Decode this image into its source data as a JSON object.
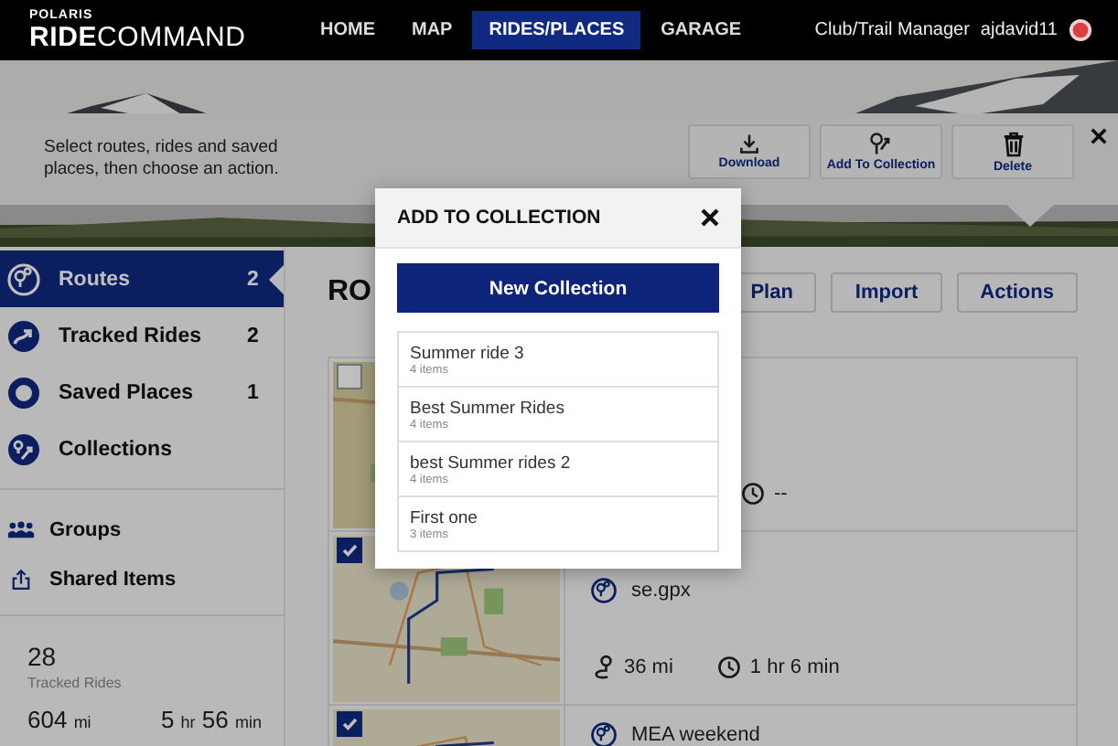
{
  "nav": {
    "brand_top": "POLARIS",
    "brand": "**RIDE**COMMAND",
    "items": [
      {
        "label": "HOME",
        "selected": false
      },
      {
        "label": "MAP",
        "selected": false
      },
      {
        "label": "RIDES/PLACES",
        "selected": true
      },
      {
        "label": "GARAGE",
        "selected": false
      }
    ],
    "manager_link": "Club/Trail Manager",
    "user": "ajdavid11"
  },
  "action_bar": {
    "hint": "Select routes, rides and saved places, then choose an action.",
    "actions": [
      {
        "kind": "download",
        "label": "Download"
      },
      {
        "kind": "collection",
        "label": "Add To Collection"
      },
      {
        "kind": "delete",
        "label": "Delete"
      }
    ]
  },
  "sidebar": {
    "categories": [
      {
        "kind": "routes",
        "label": "Routes",
        "count": "2",
        "selected": true
      },
      {
        "kind": "tracked",
        "label": "Tracked Rides",
        "count": "2",
        "selected": false
      },
      {
        "kind": "places",
        "label": "Saved Places",
        "count": "1",
        "selected": false
      },
      {
        "kind": "collections",
        "label": "Collections",
        "selected": false
      }
    ],
    "links": [
      {
        "kind": "groups",
        "label": "Groups"
      },
      {
        "kind": "shared",
        "label": "Shared Items"
      }
    ],
    "stats": {
      "count": "28",
      "count_label": "Tracked Rides",
      "distance": "604",
      "distance_unit": "mi",
      "hours": "5",
      "hours_unit": "hr",
      "minutes": "56",
      "minutes_unit": "min"
    }
  },
  "main": {
    "heading": "RO",
    "buttons": [
      "Plan",
      "Import",
      "Actions"
    ],
    "routes": [
      {
        "checked": false,
        "duration": "--"
      },
      {
        "checked": true,
        "name": "se.gpx",
        "distance": "36 mi",
        "duration": "1 hr 6 min"
      },
      {
        "checked": true,
        "name": "MEA weekend"
      }
    ]
  },
  "modal": {
    "title": "ADD TO COLLECTION",
    "new_button": "New Collection",
    "collections": [
      {
        "name": "Summer ride 3",
        "count": "4 items"
      },
      {
        "name": "Best Summer Rides",
        "count": "4 items"
      },
      {
        "name": "best Summer rides 2",
        "count": "4 items"
      },
      {
        "name": "First one",
        "count": "3 items"
      }
    ]
  }
}
